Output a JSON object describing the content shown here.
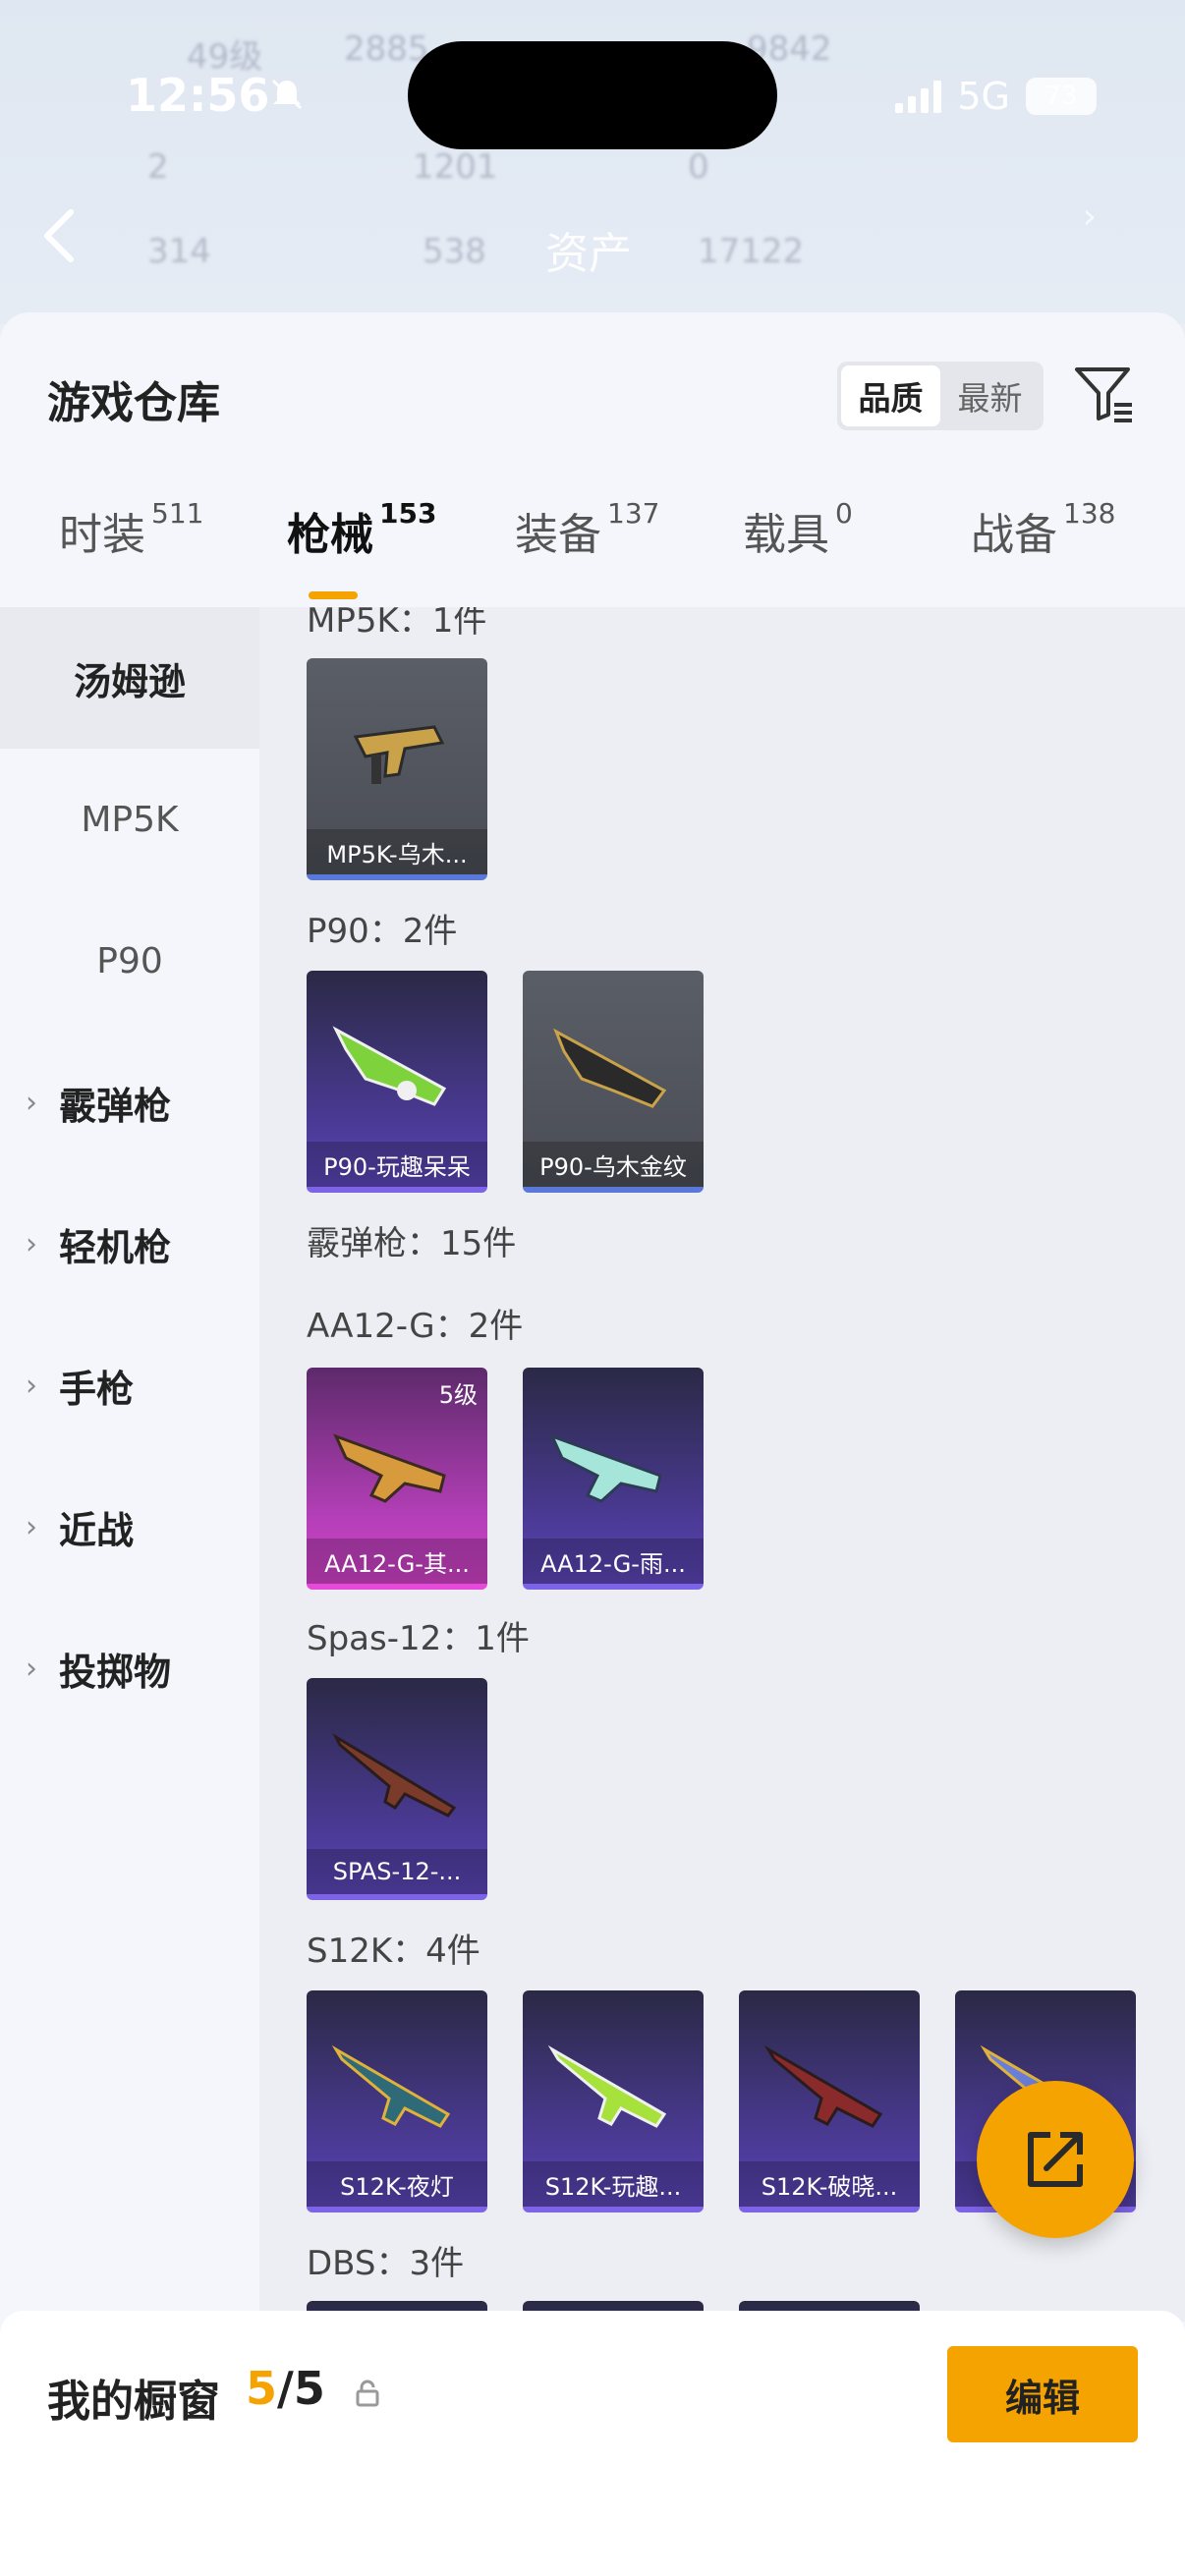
{
  "status": {
    "time": "12:56",
    "network": "5G",
    "battery": "73"
  },
  "nav": {
    "title": "资产"
  },
  "header": {
    "title": "游戏仓库",
    "sort_options": [
      "品质",
      "最新"
    ],
    "sort_selected": "品质"
  },
  "tabs": [
    {
      "label": "时装",
      "count": "511"
    },
    {
      "label": "枪械",
      "count": "153"
    },
    {
      "label": "装备",
      "count": "137"
    },
    {
      "label": "载具",
      "count": "0"
    },
    {
      "label": "战备",
      "count": "138"
    }
  ],
  "active_tab": "枪械",
  "categories": [
    {
      "label": "汤姆逊"
    },
    {
      "label": "MP5K"
    },
    {
      "label": "P90"
    },
    {
      "label": "霰弹枪"
    },
    {
      "label": "轻机枪"
    },
    {
      "label": "手枪"
    },
    {
      "label": "近战"
    },
    {
      "label": "投掷物"
    }
  ],
  "sections": {
    "mp5k": {
      "label": "MP5K：1件",
      "items": [
        {
          "name": "MP5K-乌木..."
        }
      ]
    },
    "p90": {
      "label": "P90：2件",
      "items": [
        {
          "name": "P90-玩趣呆呆"
        },
        {
          "name": "P90-乌木金纹"
        }
      ]
    },
    "shotgun": {
      "label": "霰弹枪：15件"
    },
    "aa12": {
      "label": "AA12-G：2件",
      "items": [
        {
          "name": "AA12-G-其...",
          "level": "5级"
        },
        {
          "name": "AA12-G-雨..."
        }
      ]
    },
    "spas": {
      "label": "Spas-12：1件",
      "items": [
        {
          "name": "SPAS-12-..."
        }
      ]
    },
    "s12k": {
      "label": "S12K：4件",
      "items": [
        {
          "name": "S12K-夜灯"
        },
        {
          "name": "S12K-玩趣..."
        },
        {
          "name": "S12K-破晓..."
        },
        {
          "name": "S"
        }
      ]
    },
    "dbs": {
      "label": "DBS：3件"
    }
  },
  "showcase": {
    "label": "我的橱窗",
    "current": "5",
    "separator": "/",
    "total": "5",
    "edit_label": "编辑"
  },
  "colors": {
    "accent": "#f5a300",
    "gray_card": "#51545c",
    "purple_card": "#4b3a95",
    "pink_card": "#b53fb8"
  }
}
